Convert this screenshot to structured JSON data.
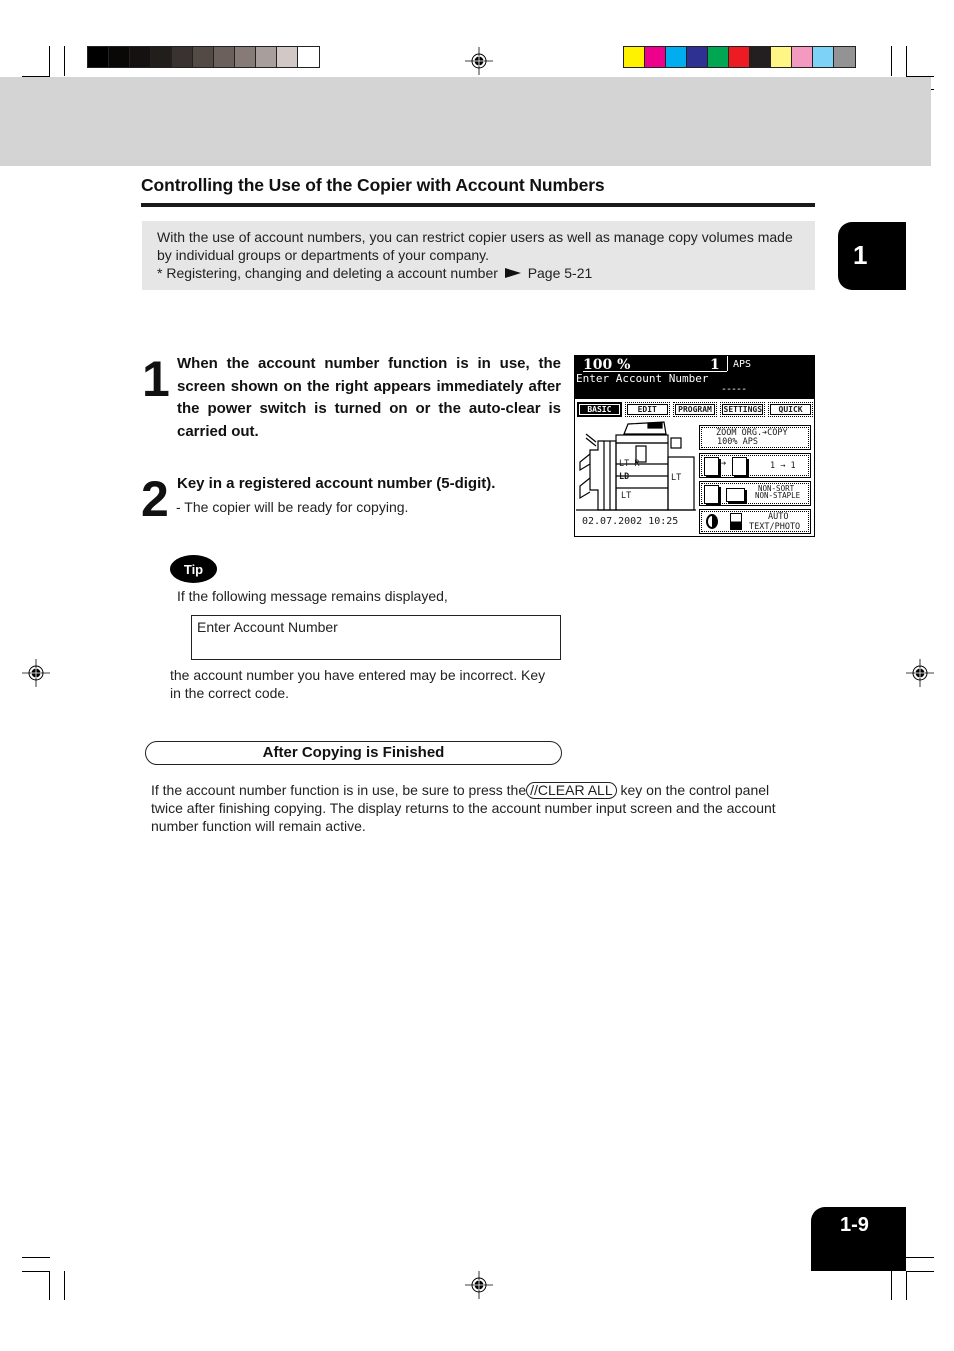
{
  "header": {
    "grayscale_swatches": [
      "#000000",
      "#0a0806",
      "#141110",
      "#221e1c",
      "#3a3230",
      "#534a46",
      "#6b605c",
      "#877b77",
      "#a89e9b",
      "#d2c8c6",
      "#ffffff"
    ],
    "color_swatches": [
      "#fff200",
      "#ec008c",
      "#00aeef",
      "#2e3192",
      "#00a651",
      "#ed1c24",
      "#231f20",
      "#fff685",
      "#f49ac1",
      "#7dd3f7",
      "#939393"
    ]
  },
  "section": {
    "title": "Controlling the Use of the Copier with Account Numbers",
    "intro_line1": "With the use of account numbers, you can restrict copier users as well as manage copy volumes made",
    "intro_line2": "by individual groups or departments of your company.",
    "ref_text": "* Registering, changing and deleting a account number",
    "ref_page": "Page 5-21"
  },
  "chapter_tab": "1",
  "steps": [
    {
      "number": "1",
      "text": "When the account number function is in use, the screen shown on the right appears immediately after the power switch is turned on or the auto-clear is carried out."
    },
    {
      "number": "2",
      "text": "Key in a registered account number (5-digit).",
      "sub": "-  The copier will be ready for copying."
    }
  ],
  "lcd": {
    "zoom_value": "100  %",
    "copy_count": "1",
    "paper_mode": "APS",
    "message": "Enter Account Number",
    "input_mask": "-----",
    "tabs": [
      "BASIC",
      "EDIT",
      "PROGRAM",
      "SETTINGS",
      "QUICK"
    ],
    "active_tab": "BASIC",
    "trays": [
      "LT-R",
      "LD",
      "LT"
    ],
    "bypass_tray": "LT",
    "buttons": [
      {
        "line1": "ZOOM   ORG.➔COPY",
        "line2": "100%      APS"
      },
      {
        "line1": "1 → 1",
        "line2": ""
      },
      {
        "line1": "NON-SORT",
        "line2": "NON-STAPLE"
      },
      {
        "line1": "AUTO",
        "line2": "TEXT/PHOTO"
      }
    ],
    "datetime": "02.07.2002 10:25"
  },
  "tip": {
    "label": "Tip",
    "before": "If the following message remains displayed,",
    "message": "Enter Account Number",
    "after_line1": "the account number you have entered may be incorrect. Key",
    "after_line2": "in the correct code."
  },
  "after_copying": {
    "heading": "After Copying is Finished",
    "line1_pre": "If the account number function is in use, be sure to press the",
    "key_label": "//CLEAR ALL",
    "line1_post": "key on the control panel",
    "line2": "twice after finishing copying. The display returns to the account number input screen and the account",
    "line3": "number function will remain active."
  },
  "page_number": "1-9"
}
